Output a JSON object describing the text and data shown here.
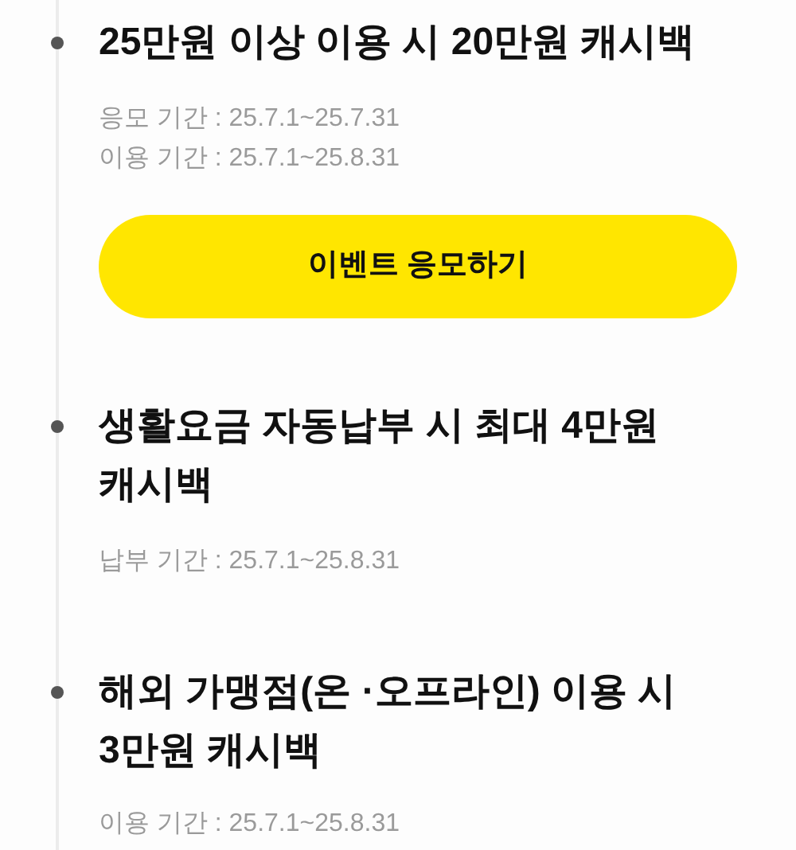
{
  "events": [
    {
      "title": "25만원 이상 이용 시 20만원 캐시백",
      "periods": [
        "응모 기간 : 25.7.1~25.7.31",
        "이용 기간 : 25.7.1~25.8.31"
      ],
      "button": "이벤트 응모하기"
    },
    {
      "title": "생활요금 자동납부 시 최대 4만원 캐시백",
      "periods": [
        "납부 기간 : 25.7.1~25.8.31"
      ]
    },
    {
      "title": "해외 가맹점(온 ·오프라인) 이용 시 3만원 캐시백",
      "periods": [
        "이용 기간 : 25.7.1~25.8.31"
      ]
    }
  ]
}
